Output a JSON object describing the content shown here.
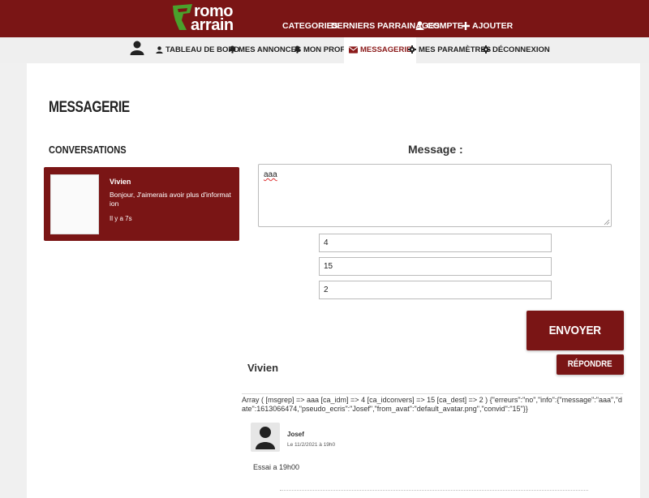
{
  "brand": {
    "line1": "romo",
    "line2": "arrain",
    "logo_color": "#4aa02c"
  },
  "colors": {
    "primary": "#7a1515",
    "bar_bg": "#efefef",
    "panel_bg": "#ffffff"
  },
  "topnav": {
    "categories": "CATEGORIES",
    "parrainages": "DERNIERS PARRAINAGES",
    "compte": "COMPTE",
    "ajouter": "AJOUTER"
  },
  "subnav": {
    "tableau": "TABLEAU DE BORD",
    "annonces": "MES ANNONCES",
    "profil": "MON PROFIL",
    "messagerie": "MESSAGERIE",
    "parametres": "MES PARAMÈTRES",
    "deconnexion": "DÉCONNEXION"
  },
  "page": {
    "title": "MESSAGERIE",
    "conversations_heading": "CONVERSATIONS",
    "message_heading": "Message :"
  },
  "conversation": {
    "name": "Vivien",
    "preview": "Bonjour, J'aimerais avoir plus d'information",
    "time": "Il y a 7s"
  },
  "form": {
    "message_value": "aaa",
    "field1_value": "4",
    "field2_value": "15",
    "field3_value": "2",
    "send_label": "ENVOYER",
    "reply_label": "RÉPONDRE"
  },
  "thread": {
    "name": "Vivien",
    "debug_output": "Array ( [msgrep] => aaa [ca_idm] => 4 [ca_idconvers] => 15 [ca_dest] => 2 ) {\"erreurs\":\"no\",\"info\":{\"message\":\"aaa\",\"date\":1613066474,\"pseudo_ecris\":\"Josef\",\"from_avat\":\"default_avatar.png\",\"convid\":\"15\"}}",
    "messages": [
      {
        "from": "Josef",
        "date": "Le 11/2/2021 à 19h0",
        "body": "Essai a 19h00"
      }
    ]
  }
}
